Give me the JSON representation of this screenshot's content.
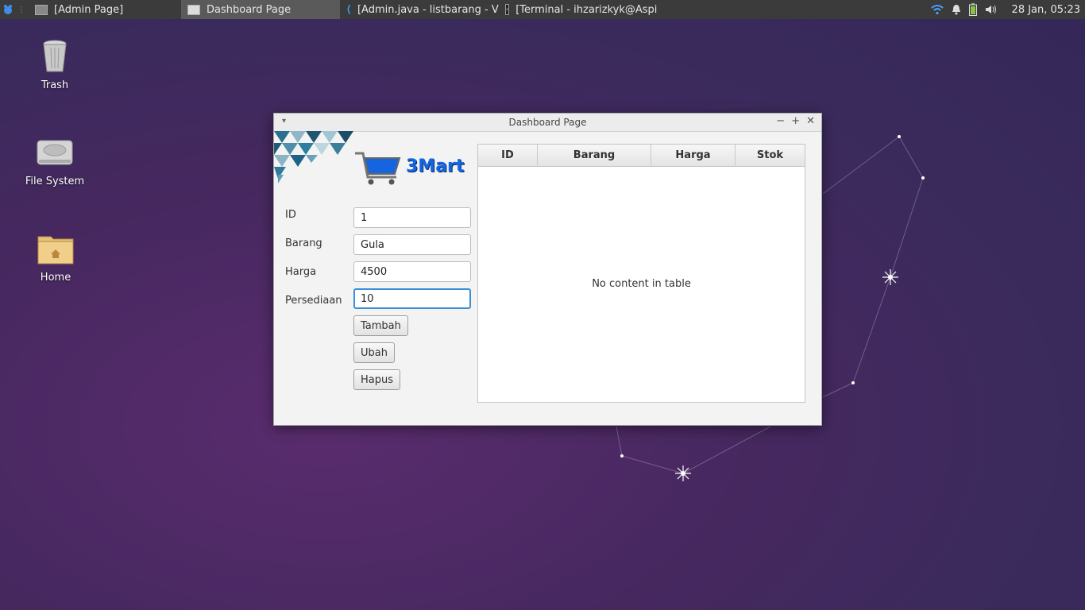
{
  "taskbar": {
    "tasks": [
      {
        "label": "[Admin Page]"
      },
      {
        "label": "Dashboard Page"
      },
      {
        "label": "[Admin.java - listbarang - Vis..."
      },
      {
        "label": "[Terminal - ihzarizkyk@Aspir..."
      }
    ],
    "clock": "28 Jan, 05:23"
  },
  "desktop": {
    "icons": [
      {
        "label": "Trash"
      },
      {
        "label": "File System"
      },
      {
        "label": "Home"
      }
    ]
  },
  "window": {
    "title": "Dashboard Page",
    "logo_text": "3Mart",
    "form": {
      "id_label": "ID",
      "id_value": "1",
      "barang_label": "Barang",
      "barang_value": "Gula",
      "harga_label": "Harga",
      "harga_value": "4500",
      "persediaan_label": "Persediaan",
      "persediaan_value": "10"
    },
    "buttons": {
      "tambah": "Tambah",
      "ubah": "Ubah",
      "hapus": "Hapus"
    },
    "table": {
      "columns": [
        "ID",
        "Barang",
        "Harga",
        "Stok"
      ],
      "empty_text": "No content in table"
    }
  },
  "colors": {
    "accent": "#3a8fd6",
    "logo_blue": "#1565e0"
  }
}
